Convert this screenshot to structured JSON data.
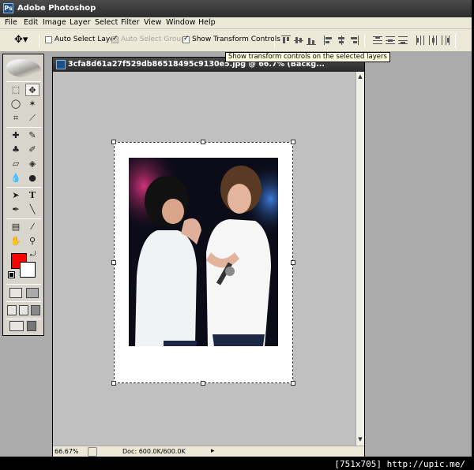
{
  "app": {
    "title": "Adobe Photoshop"
  },
  "menu": [
    "File",
    "Edit",
    "Image",
    "Layer",
    "Select",
    "Filter",
    "View",
    "Window",
    "Help"
  ],
  "options": {
    "auto_select_layer": {
      "label": "Auto Select Layer",
      "checked": false
    },
    "auto_select_groups": {
      "label": "Auto Select Groups",
      "checked": true,
      "disabled": true
    },
    "show_transform_controls": {
      "label": "Show Transform Controls",
      "checked": true
    }
  },
  "tooltip": "Show transform controls on the selected layers",
  "document": {
    "title": "3cfa8d61a27f529db86518495c9130e5.jpg @ 66.7% (Backg...",
    "zoom": "66.67%",
    "doc_info": "Doc: 600.0K/600.0K"
  },
  "colors": {
    "foreground": "#ff0000",
    "background": "#ffffff",
    "accent": "#1b4f8a"
  },
  "footer": "[751x705] http://upic.me/"
}
